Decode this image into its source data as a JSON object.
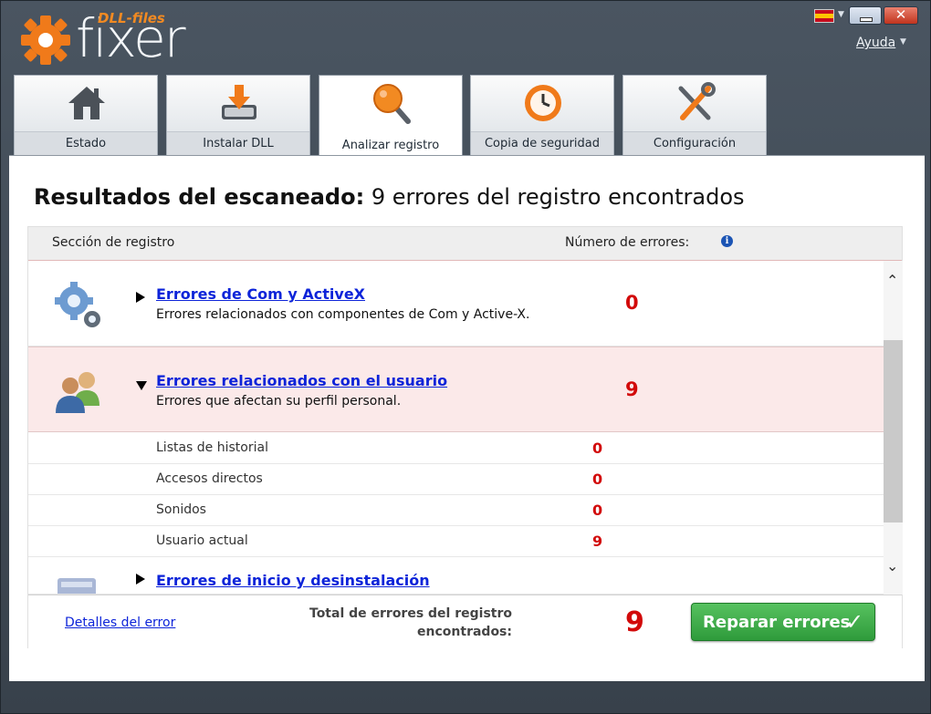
{
  "header": {
    "logo_small": "DLL-files",
    "logo_big": "fixer",
    "help_label": "Ayuda"
  },
  "tabs": [
    {
      "label": "Estado",
      "icon": "home-icon"
    },
    {
      "label": "Instalar DLL",
      "icon": "install-icon"
    },
    {
      "label": "Analizar registro",
      "icon": "magnifier-icon",
      "active": true
    },
    {
      "label": "Copia de seguridad",
      "icon": "clock-backup-icon"
    },
    {
      "label": "Configuración",
      "icon": "tools-icon"
    }
  ],
  "main": {
    "title_bold": "Resultados del escaneado:",
    "title_rest": "9 errores del registro encontrados",
    "col_section": "Sección de registro",
    "col_count": "Número de errores:",
    "categories": [
      {
        "title": "Errores de Com y ActiveX",
        "desc": "Errores relacionados con componentes de Com y Active-X.",
        "count": "0",
        "icon": "gears-icon",
        "expanded": false
      },
      {
        "title": "Errores relacionados con el usuario",
        "desc": "Errores que afectan su perfil personal.",
        "count": "9",
        "icon": "users-icon",
        "expanded": true
      },
      {
        "title": "Errores de inicio y desinstalación",
        "icon": "startup-icon",
        "expanded": false
      }
    ],
    "subitems": [
      {
        "label": "Listas de historial",
        "count": "0"
      },
      {
        "label": "Accesos directos",
        "count": "0"
      },
      {
        "label": "Sonidos",
        "count": "0"
      },
      {
        "label": "Usuario actual",
        "count": "9"
      }
    ]
  },
  "footer": {
    "details_link": "Detalles del error",
    "total_label_1": "Total de errores del registro",
    "total_label_2": "encontrados:",
    "total_count": "9",
    "repair_label": "Reparar errores"
  },
  "colors": {
    "accent_orange": "#f28a22",
    "error_red": "#d20a0a",
    "link_blue": "#0d24d9",
    "repair_green": "#3aa847"
  }
}
